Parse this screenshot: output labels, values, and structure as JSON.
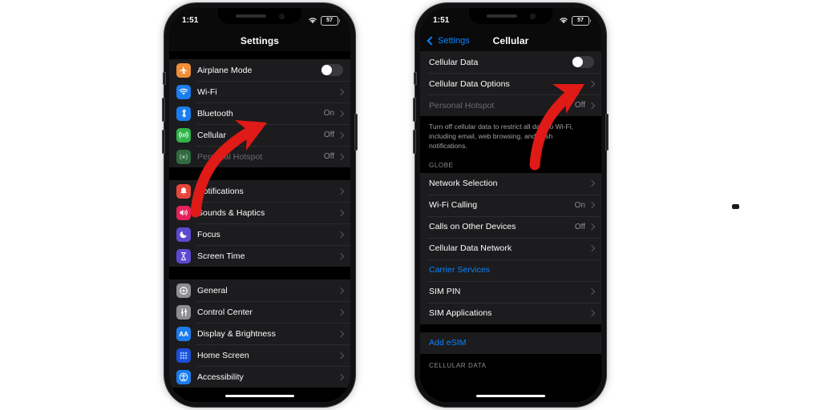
{
  "meta": {
    "background_color": "#ffffff",
    "accent_blue": "#0a84ff",
    "arrow_color": "#e01a16"
  },
  "phone_left": {
    "status_bar": {
      "time": "1:51",
      "wifi_icon": "wifi-icon",
      "battery_level": "57",
      "battery_icon": "battery-icon"
    },
    "nav": {
      "title": "Settings"
    },
    "groups": [
      {
        "name": "connectivity",
        "rows": [
          {
            "label": "Airplane Mode",
            "icon": "airplane-icon",
            "icon_color": "#ef8e38",
            "control": "toggle",
            "toggle_on": false
          },
          {
            "label": "Wi-Fi",
            "icon": "wifi-icon",
            "icon_color": "#1b7ced",
            "control": "chevron",
            "value": ""
          },
          {
            "label": "Bluetooth",
            "icon": "bluetooth-icon",
            "icon_color": "#1b7ced",
            "control": "chevron",
            "value": "On"
          },
          {
            "label": "Cellular",
            "icon": "cellular-icon",
            "icon_color": "#30b44a",
            "control": "chevron",
            "value": "Off"
          },
          {
            "label": "Personal Hotspot",
            "icon": "hotspot-icon",
            "icon_color": "#2f6b3c",
            "control": "chevron",
            "value": "Off",
            "dim": true
          }
        ]
      },
      {
        "name": "alerts",
        "rows": [
          {
            "label": "Notifications",
            "icon": "notifications-icon",
            "icon_color": "#e8463c",
            "control": "chevron",
            "value": ""
          },
          {
            "label": "Sounds & Haptics",
            "icon": "sounds-icon",
            "icon_color": "#e6225a",
            "control": "chevron",
            "value": ""
          },
          {
            "label": "Focus",
            "icon": "focus-moon-icon",
            "icon_color": "#5a4ad1",
            "control": "chevron",
            "value": ""
          },
          {
            "label": "Screen Time",
            "icon": "screen-time-icon",
            "icon_color": "#5a4ad1",
            "control": "chevron",
            "value": ""
          }
        ]
      },
      {
        "name": "system",
        "rows": [
          {
            "label": "General",
            "icon": "gear-icon",
            "icon_color": "#8e8e93",
            "control": "chevron",
            "value": ""
          },
          {
            "label": "Control Center",
            "icon": "control-center-icon",
            "icon_color": "#8e8e93",
            "control": "chevron",
            "value": ""
          },
          {
            "label": "Display & Brightness",
            "icon": "display-aa-icon",
            "icon_color": "#1b7ced",
            "control": "chevron",
            "value": ""
          },
          {
            "label": "Home Screen",
            "icon": "home-screen-icon",
            "icon_color": "#1d4ed8",
            "control": "chevron",
            "value": ""
          },
          {
            "label": "Accessibility",
            "icon": "accessibility-icon",
            "icon_color": "#1b7ced",
            "control": "chevron",
            "value": ""
          }
        ]
      }
    ]
  },
  "phone_right": {
    "status_bar": {
      "time": "1:51",
      "wifi_icon": "wifi-icon",
      "battery_level": "57",
      "battery_icon": "battery-icon"
    },
    "nav": {
      "back_label": "Settings",
      "title": "Cellular"
    },
    "rows_top": [
      {
        "label": "Cellular Data",
        "control": "toggle",
        "toggle_on": false
      },
      {
        "label": "Cellular Data Options",
        "control": "chevron",
        "value": ""
      },
      {
        "label": "Personal Hotspot",
        "control": "chevron",
        "value": "Off",
        "dim": true
      }
    ],
    "description": "Turn off cellular data to restrict all data to Wi-Fi, including email, web browsing, and push notifications.",
    "section_header": "GLOBE",
    "rows_carrier": [
      {
        "label": "Network Selection",
        "control": "chevron",
        "value": ""
      },
      {
        "label": "Wi-Fi Calling",
        "control": "chevron",
        "value": "On"
      },
      {
        "label": "Calls on Other Devices",
        "control": "chevron",
        "value": "Off"
      },
      {
        "label": "Cellular Data Network",
        "control": "chevron",
        "value": ""
      },
      {
        "label": "Carrier Services",
        "control": "none",
        "value": "",
        "link": true
      },
      {
        "label": "SIM PIN",
        "control": "chevron",
        "value": ""
      },
      {
        "label": "SIM Applications",
        "control": "chevron",
        "value": ""
      }
    ],
    "rows_esim": [
      {
        "label": "Add eSIM",
        "control": "none",
        "value": "",
        "link": true
      }
    ],
    "section_header_bottom": "CELLULAR DATA"
  },
  "annotations": [
    {
      "name": "arrow-to-cellular-row",
      "color": "#e01a16"
    },
    {
      "name": "arrow-to-cellular-data-toggle",
      "color": "#e01a16"
    }
  ]
}
